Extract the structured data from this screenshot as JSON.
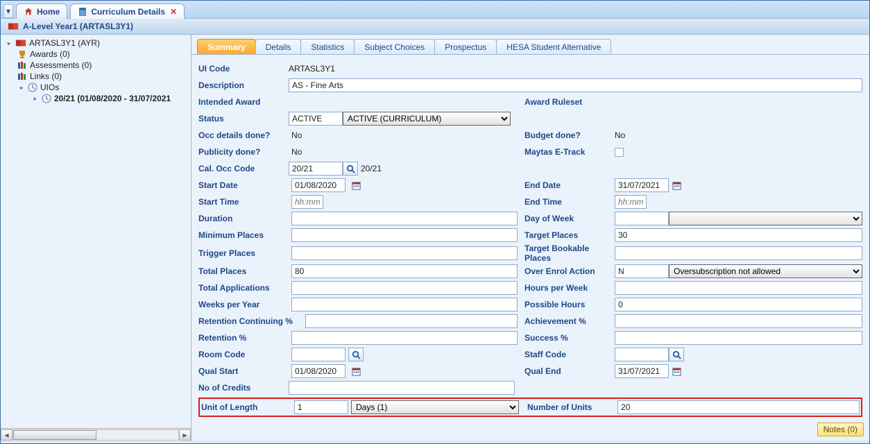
{
  "topbar": {
    "tabs": [
      {
        "label": "Home"
      },
      {
        "label": "Curriculum Details"
      }
    ]
  },
  "title": "A-Level Year1 (ARTASL3Y1)",
  "tree": {
    "root": "ARTASL3Y1 (AYR)",
    "awards": "Awards (0)",
    "assessments": "Assessments (0)",
    "links": "Links (0)",
    "uios": "UIOs",
    "uio_item": "20/21 (01/08/2020 - 31/07/2021"
  },
  "innerTabs": [
    "Summary",
    "Details",
    "Statistics",
    "Subject Choices",
    "Prospectus",
    "HESA Student Alternative"
  ],
  "form": {
    "uiCode": {
      "label": "UI Code",
      "value": "ARTASL3Y1"
    },
    "description": {
      "label": "Description",
      "value": "AS - Fine Arts"
    },
    "intendedAward": {
      "label": "Intended Award"
    },
    "awardRuleset": {
      "label": "Award Ruleset"
    },
    "status": {
      "label": "Status",
      "code": "ACTIVE",
      "desc": "ACTIVE (CURRICULUM)"
    },
    "occDetails": {
      "label": "Occ details done?",
      "value": "No"
    },
    "budgetDone": {
      "label": "Budget done?",
      "value": "No"
    },
    "publicityDone": {
      "label": "Publicity done?",
      "value": "No"
    },
    "maytas": {
      "label": "Maytas E-Track"
    },
    "calOcc": {
      "label": "Cal. Occ Code",
      "code": "20/21",
      "desc": "20/21"
    },
    "startDate": {
      "label": "Start Date",
      "value": "01/08/2020"
    },
    "endDate": {
      "label": "End Date",
      "value": "31/07/2021"
    },
    "startTime": {
      "label": "Start Time",
      "placeholder": "hh:mm"
    },
    "endTime": {
      "label": "End Time",
      "placeholder": "hh:mm"
    },
    "duration": {
      "label": "Duration"
    },
    "dayOfWeek": {
      "label": "Day of Week"
    },
    "minPlaces": {
      "label": "Minimum Places"
    },
    "targetPlaces": {
      "label": "Target Places",
      "value": "30"
    },
    "triggerPlaces": {
      "label": "Trigger Places"
    },
    "targetBookable": {
      "label": "Target Bookable Places"
    },
    "totalPlaces": {
      "label": "Total Places",
      "value": "80"
    },
    "overEnrol": {
      "label": "Over Enrol Action",
      "code": "N",
      "desc": "Oversubscription not allowed"
    },
    "totalApps": {
      "label": "Total Applications"
    },
    "hoursPerWeek": {
      "label": "Hours per Week"
    },
    "weeksPerYear": {
      "label": "Weeks per Year"
    },
    "possibleHours": {
      "label": "Possible Hours",
      "value": "0"
    },
    "retContPct": {
      "label": "Retention Continuing %"
    },
    "achPct": {
      "label": "Achievement %"
    },
    "retPct": {
      "label": "Retention %"
    },
    "successPct": {
      "label": "Success %"
    },
    "roomCode": {
      "label": "Room Code"
    },
    "staffCode": {
      "label": "Staff Code"
    },
    "qualStart": {
      "label": "Qual Start",
      "value": "01/08/2020"
    },
    "qualEnd": {
      "label": "Qual End",
      "value": "31/07/2021"
    },
    "noCredits": {
      "label": "No of Credits"
    },
    "unitOfLength": {
      "label": "Unit of Length",
      "code": "1",
      "desc": "Days (1)"
    },
    "numberOfUnits": {
      "label": "Number of Units",
      "value": "20"
    }
  },
  "notes": "Notes (0)"
}
